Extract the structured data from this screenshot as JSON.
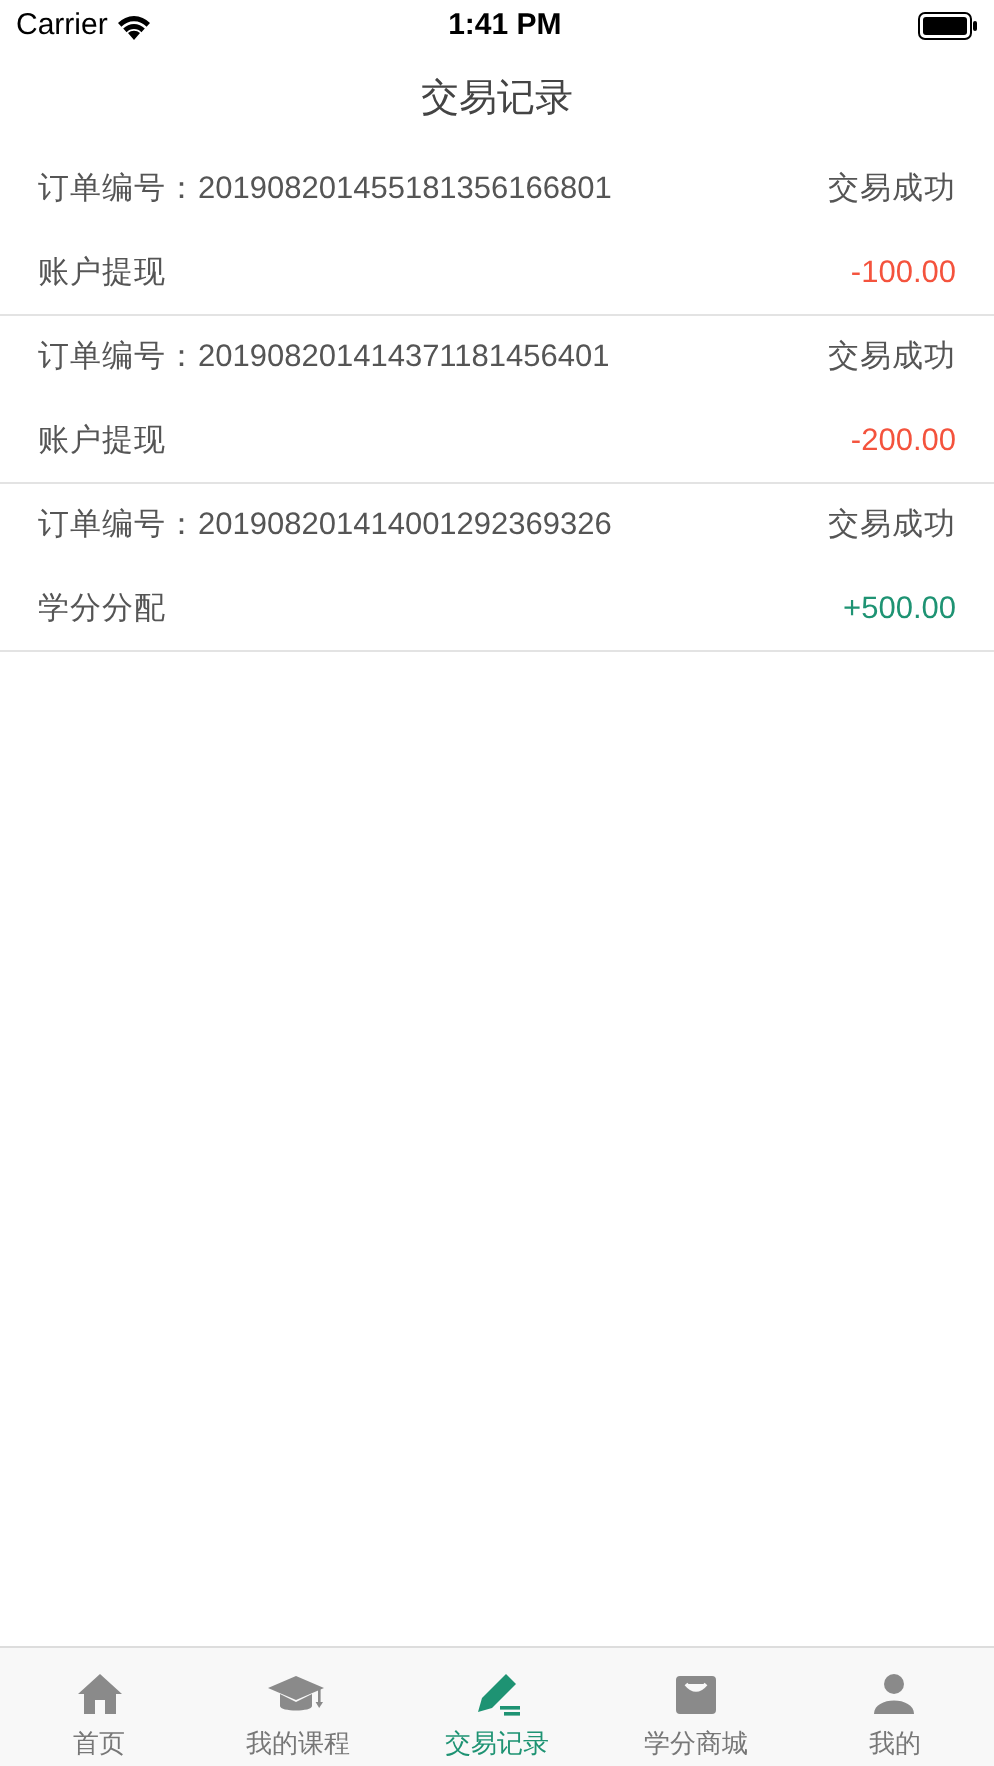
{
  "status_bar": {
    "carrier": "Carrier",
    "time": "1:41 PM"
  },
  "title": "交易记录",
  "records": [
    {
      "order_label": "订单编号：",
      "order_no": "201908201455181356166801",
      "status": "交易成功",
      "type": "账户提现",
      "amount": "-100.00",
      "color": "#f4533d"
    },
    {
      "order_label": "订单编号：",
      "order_no": "201908201414371181456401",
      "status": "交易成功",
      "type": "账户提现",
      "amount": "-200.00",
      "color": "#f4533d"
    },
    {
      "order_label": "订单编号：",
      "order_no": "201908201414001292369326",
      "status": "交易成功",
      "type": "学分分配",
      "amount": "+500.00",
      "color": "#1e9373"
    }
  ],
  "tabs": [
    {
      "label": "首页",
      "kind": "home",
      "selected": false
    },
    {
      "label": "我的课程",
      "kind": "courses",
      "selected": false
    },
    {
      "label": "交易记录",
      "kind": "records",
      "selected": true
    },
    {
      "label": "学分商城",
      "kind": "shop",
      "selected": false
    },
    {
      "label": "我的",
      "kind": "profile",
      "selected": false
    }
  ]
}
